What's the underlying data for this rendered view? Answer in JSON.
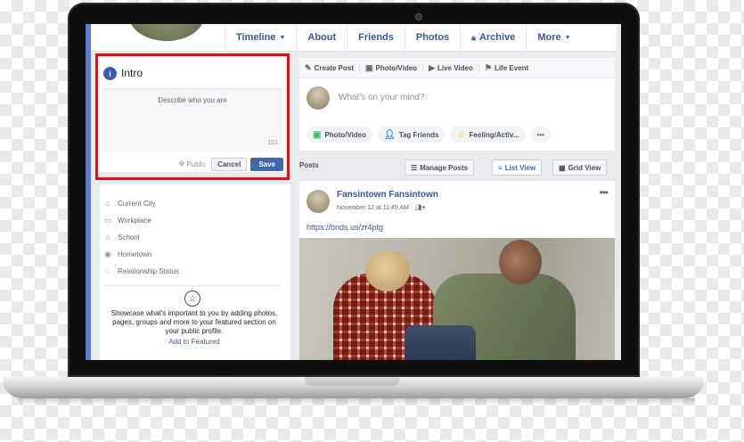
{
  "nav": {
    "tabs": [
      {
        "label": "Timeline",
        "has_caret": true
      },
      {
        "label": "About"
      },
      {
        "label": "Friends"
      },
      {
        "label": "Photos"
      },
      {
        "label": "Archive",
        "icon": "lock-icon"
      },
      {
        "label": "More",
        "has_caret": true
      }
    ]
  },
  "intro": {
    "title": "Intro",
    "bio_placeholder": "Describe who you are",
    "char_counter": "101",
    "privacy": "Public",
    "cancel": "Cancel",
    "save": "Save",
    "highlight_color": "#e0101a"
  },
  "details": {
    "items": [
      {
        "label": "Current City",
        "icon": "home-icon"
      },
      {
        "label": "Workplace",
        "icon": "briefcase-icon"
      },
      {
        "label": "School",
        "icon": "graduation-cap-icon"
      },
      {
        "label": "Hometown",
        "icon": "location-pin-icon"
      },
      {
        "label": "Relationship Status",
        "icon": "heart-icon"
      }
    ],
    "featured_text": "Showcase what's important to you by adding photos, pages, groups and more to your featured section on your public profile.",
    "featured_link": "Add to Featured"
  },
  "composer": {
    "tabs": [
      {
        "label": "Create Post",
        "icon": "pencil-icon"
      },
      {
        "label": "Photo/Video",
        "icon": "camera-icon"
      },
      {
        "label": "Live Video",
        "icon": "video-icon"
      },
      {
        "label": "Life Event",
        "icon": "flag-icon"
      }
    ],
    "placeholder": "What's on your mind?",
    "actions": [
      {
        "label": "Photo/Video",
        "icon": "photo-icon"
      },
      {
        "label": "Tag Friends",
        "icon": "tag-friends-icon"
      },
      {
        "label": "Feeling/Activ...",
        "icon": "smiley-icon"
      }
    ],
    "more": "•••"
  },
  "posts_bar": {
    "label": "Posts",
    "manage": "Manage Posts",
    "list_view": "List View",
    "grid_view": "Grid View"
  },
  "post": {
    "author": "Fansintown Fansintown",
    "meta": "November 12 at 11:49 AM · ",
    "link": "https://bnds.us/zr4ptg",
    "menu": "•••"
  },
  "colors": {
    "accent": "#4267b2",
    "link": "#385898",
    "page_bg": "#e9ebee"
  }
}
